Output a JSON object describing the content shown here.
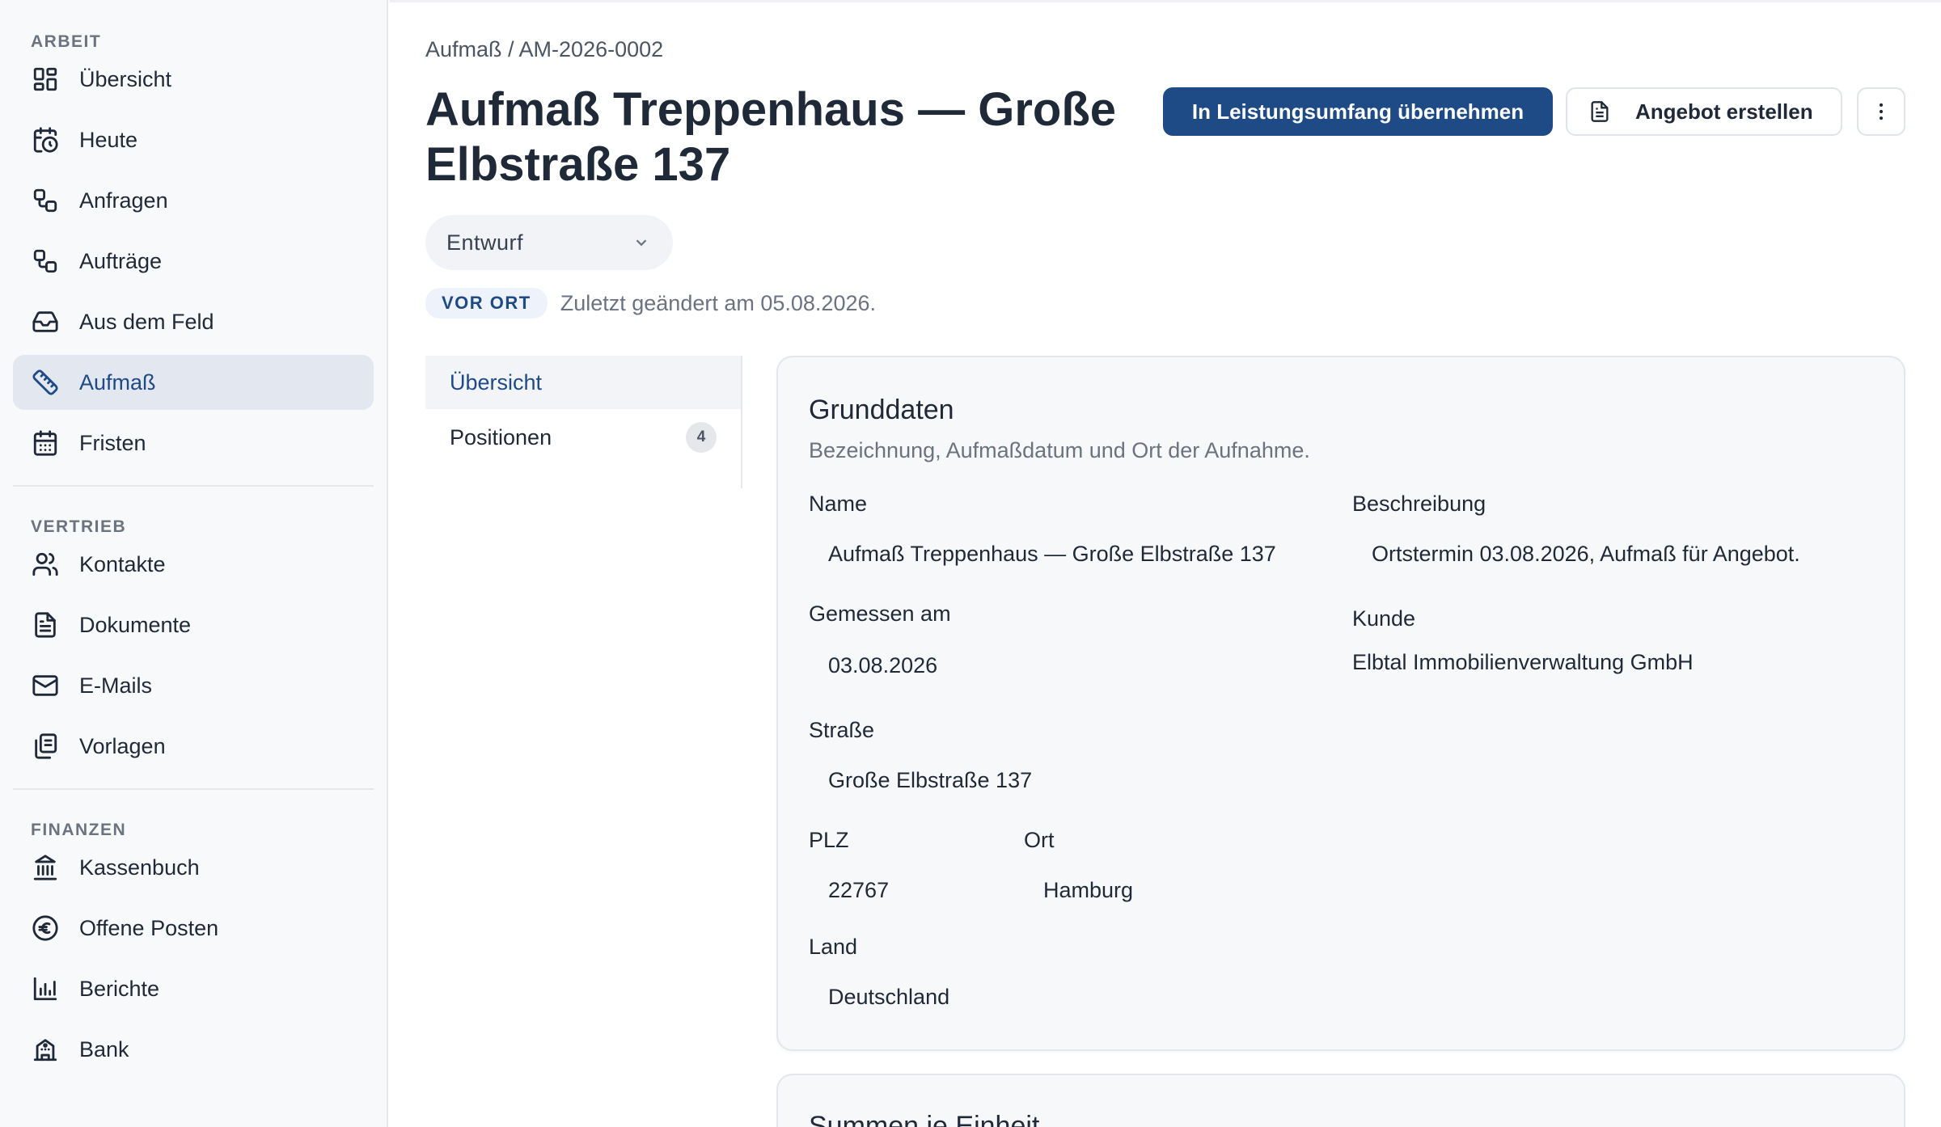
{
  "sidebar": {
    "sections": [
      {
        "title": "ARBEIT"
      },
      {
        "title": "VERTRIEB"
      },
      {
        "title": "FINANZEN"
      }
    ],
    "items": [
      {
        "label": "Übersicht",
        "icon": "grid-icon"
      },
      {
        "label": "Heute",
        "icon": "calendar-clock-icon"
      },
      {
        "label": "Anfragen",
        "icon": "workflow-icon"
      },
      {
        "label": "Aufträge",
        "icon": "workflow-icon"
      },
      {
        "label": "Aus dem Feld",
        "icon": "inbox-icon"
      },
      {
        "label": "Aufmaß",
        "icon": "ruler-icon"
      },
      {
        "label": "Fristen",
        "icon": "calendar-icon"
      },
      {
        "label": "Kontakte",
        "icon": "users-icon"
      },
      {
        "label": "Dokumente",
        "icon": "document-icon"
      },
      {
        "label": "E-Mails",
        "icon": "mail-icon"
      },
      {
        "label": "Vorlagen",
        "icon": "copy-icon"
      },
      {
        "label": "Kassenbuch",
        "icon": "bank-icon"
      },
      {
        "label": "Offene Posten",
        "icon": "euro-icon"
      },
      {
        "label": "Berichte",
        "icon": "bar-chart-icon"
      },
      {
        "label": "Bank",
        "icon": "building-icon"
      }
    ],
    "active": "Aufmaß"
  },
  "header": {
    "breadcrumb": "Aufmaß / AM-2026-0002",
    "title": "Aufmaß Treppenhaus — Große Elbstraße 137",
    "primary_button": "In Leistungsumfang übernehmen",
    "secondary_button": "Angebot erstellen",
    "status_value": "Entwurf",
    "badge": "VOR ORT",
    "last_changed": "Zuletzt geändert am 05.08.2026."
  },
  "tabs": [
    {
      "label": "Übersicht",
      "active": true
    },
    {
      "label": "Positionen",
      "count": "4"
    }
  ],
  "card": {
    "title": "Grunddaten",
    "subtitle": "Bezeichnung, Aufmaßdatum und Ort der Aufnahme.",
    "fields": {
      "name_label": "Name",
      "name_value": "Aufmaß Treppenhaus — Große Elbstraße 137",
      "beschreibung_label": "Beschreibung",
      "beschreibung_value": "Ortstermin 03.08.2026, Aufmaß für Angebot.",
      "gemessen_label": "Gemessen am",
      "gemessen_value": "03.08.2026",
      "kunde_label": "Kunde",
      "kunde_value": "Elbtal Immobilienverwaltung GmbH",
      "strasse_label": "Straße",
      "strasse_value": "Große Elbstraße 137",
      "plz_label": "PLZ",
      "plz_value": "22767",
      "ort_label": "Ort",
      "ort_value": "Hamburg",
      "land_label": "Land",
      "land_value": "Deutschland"
    }
  },
  "card2": {
    "title": "Summen je Einheit"
  },
  "colors": {
    "accent": "#1e4a86",
    "sidebar_bg": "#f8f9fb",
    "active_item_bg": "#e3e8f0"
  }
}
